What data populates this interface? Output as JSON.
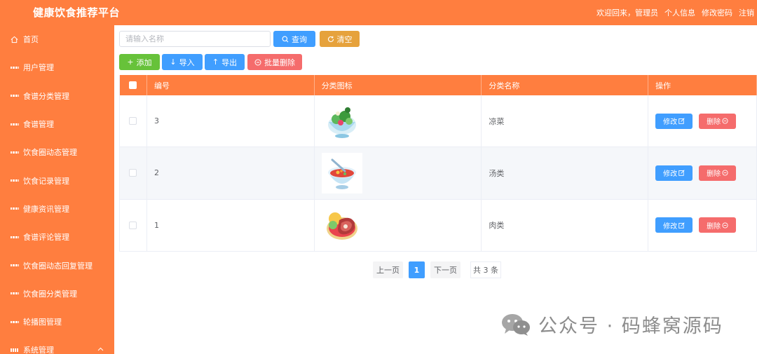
{
  "header": {
    "title": "健康饮食推荐平台",
    "welcome": "欢迎回来，管理员",
    "links": [
      "个人信息",
      "修改密码",
      "注销"
    ]
  },
  "sidebar": {
    "items": [
      {
        "label": "首页",
        "icon": "home-icon"
      },
      {
        "label": "用户管理",
        "icon": "grid-icon"
      },
      {
        "label": "食谱分类管理",
        "icon": "grid-icon"
      },
      {
        "label": "食谱管理",
        "icon": "grid-icon"
      },
      {
        "label": "饮食圈动态管理",
        "icon": "grid-icon"
      },
      {
        "label": "饮食记录管理",
        "icon": "grid-icon"
      },
      {
        "label": "健康资讯管理",
        "icon": "grid-icon"
      },
      {
        "label": "食谱评论管理",
        "icon": "grid-icon"
      },
      {
        "label": "饮食圈动态回复管理",
        "icon": "grid-icon"
      },
      {
        "label": "饮食圈分类管理",
        "icon": "grid-icon"
      },
      {
        "label": "轮播图管理",
        "icon": "grid-icon"
      },
      {
        "label": "系统管理",
        "icon": "apps-icon"
      }
    ]
  },
  "search": {
    "placeholder": "请输入名称",
    "query_label": "查询",
    "clear_label": "清空"
  },
  "toolbar": {
    "add_label": "添加",
    "import_label": "导入",
    "export_label": "导出",
    "batch_delete_label": "批量删除"
  },
  "table": {
    "columns": [
      "编号",
      "分类图标",
      "分类名称",
      "操作"
    ],
    "rows": [
      {
        "id": "3",
        "name": "凉菜",
        "icon": "salad-bowl-icon"
      },
      {
        "id": "2",
        "name": "汤类",
        "icon": "soup-bowl-icon"
      },
      {
        "id": "1",
        "name": "肉类",
        "icon": "meat-plate-icon"
      }
    ],
    "edit_label": "修改",
    "delete_label": "删除"
  },
  "pagination": {
    "prev_label": "上一页",
    "current_page": "1",
    "next_label": "下一页",
    "total_label": "共 3 条"
  },
  "watermark": {
    "text": "公众号 · 码蜂窝源码"
  },
  "colors": {
    "brand": "#ff7e3f",
    "primary": "#409eff",
    "success": "#67c23a",
    "warning": "#e6a23c",
    "danger": "#f56c6c"
  }
}
